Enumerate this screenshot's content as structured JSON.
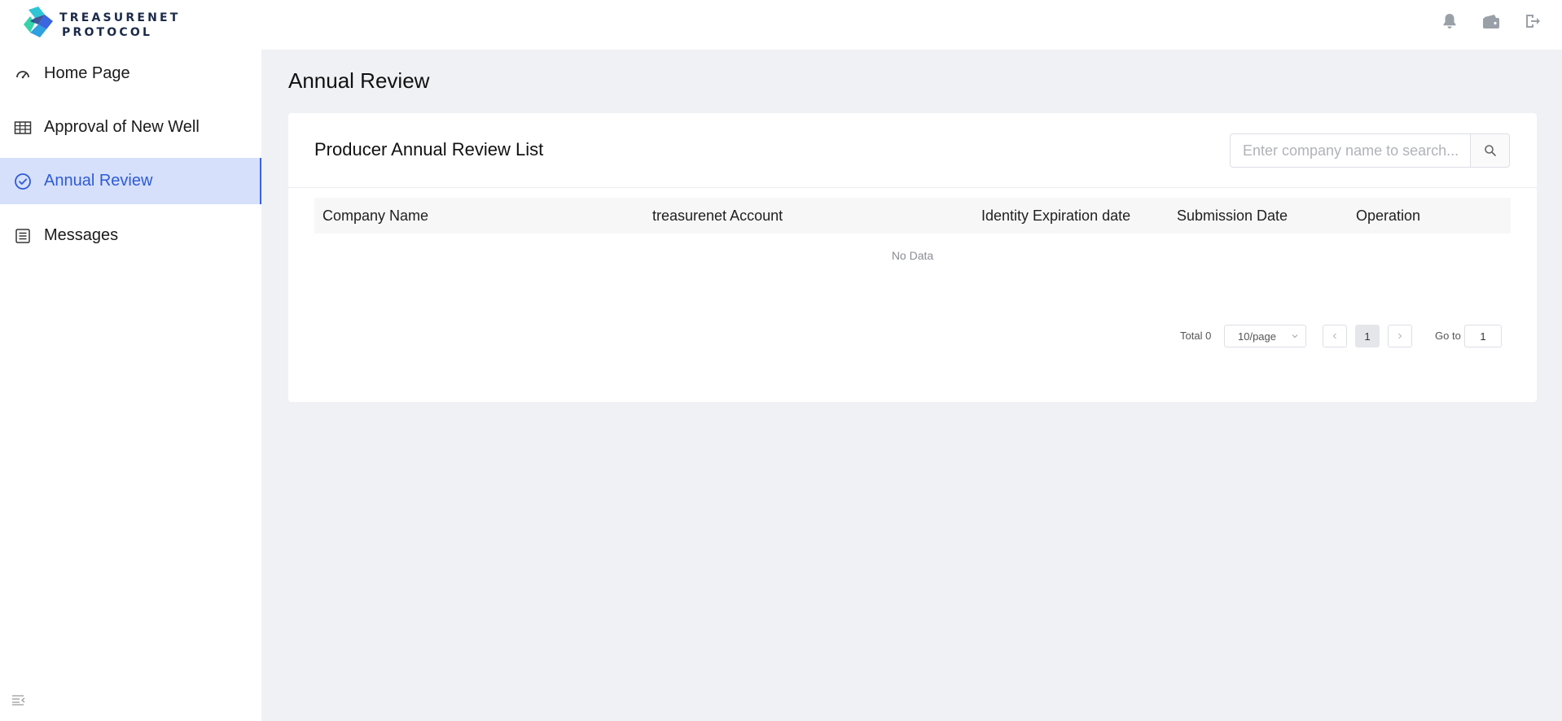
{
  "header": {
    "logo_line1": "TREASURENET",
    "logo_line2": "PROTOCOL",
    "icons": [
      "bell-icon",
      "wallet-icon",
      "logout-icon"
    ]
  },
  "sidebar": {
    "items": [
      {
        "label": "Home Page",
        "icon": "dashboard-icon"
      },
      {
        "label": "Approval of New Well",
        "icon": "table-icon"
      },
      {
        "label": "Annual Review",
        "icon": "check-circle-icon",
        "active": true
      },
      {
        "label": "Messages",
        "icon": "list-icon"
      }
    ],
    "collapse_icon": "collapse-menu-icon"
  },
  "main": {
    "page_title": "Annual Review",
    "card_title": "Producer Annual Review List",
    "search": {
      "placeholder": "Enter company name to search..."
    },
    "table": {
      "columns": [
        "Company Name",
        "treasurenet Account",
        "Identity Expiration date",
        "Submission Date",
        "Operation"
      ],
      "rows": [],
      "empty_text": "No Data"
    },
    "pagination": {
      "total_label": "Total 0",
      "page_size": "10/page",
      "current_page": "1",
      "goto_label": "Go to",
      "goto_value": "1"
    }
  },
  "colors": {
    "accent": "#2f5ad6",
    "active_bg": "#d6e0fb",
    "page_bg": "#f0f1f5"
  }
}
